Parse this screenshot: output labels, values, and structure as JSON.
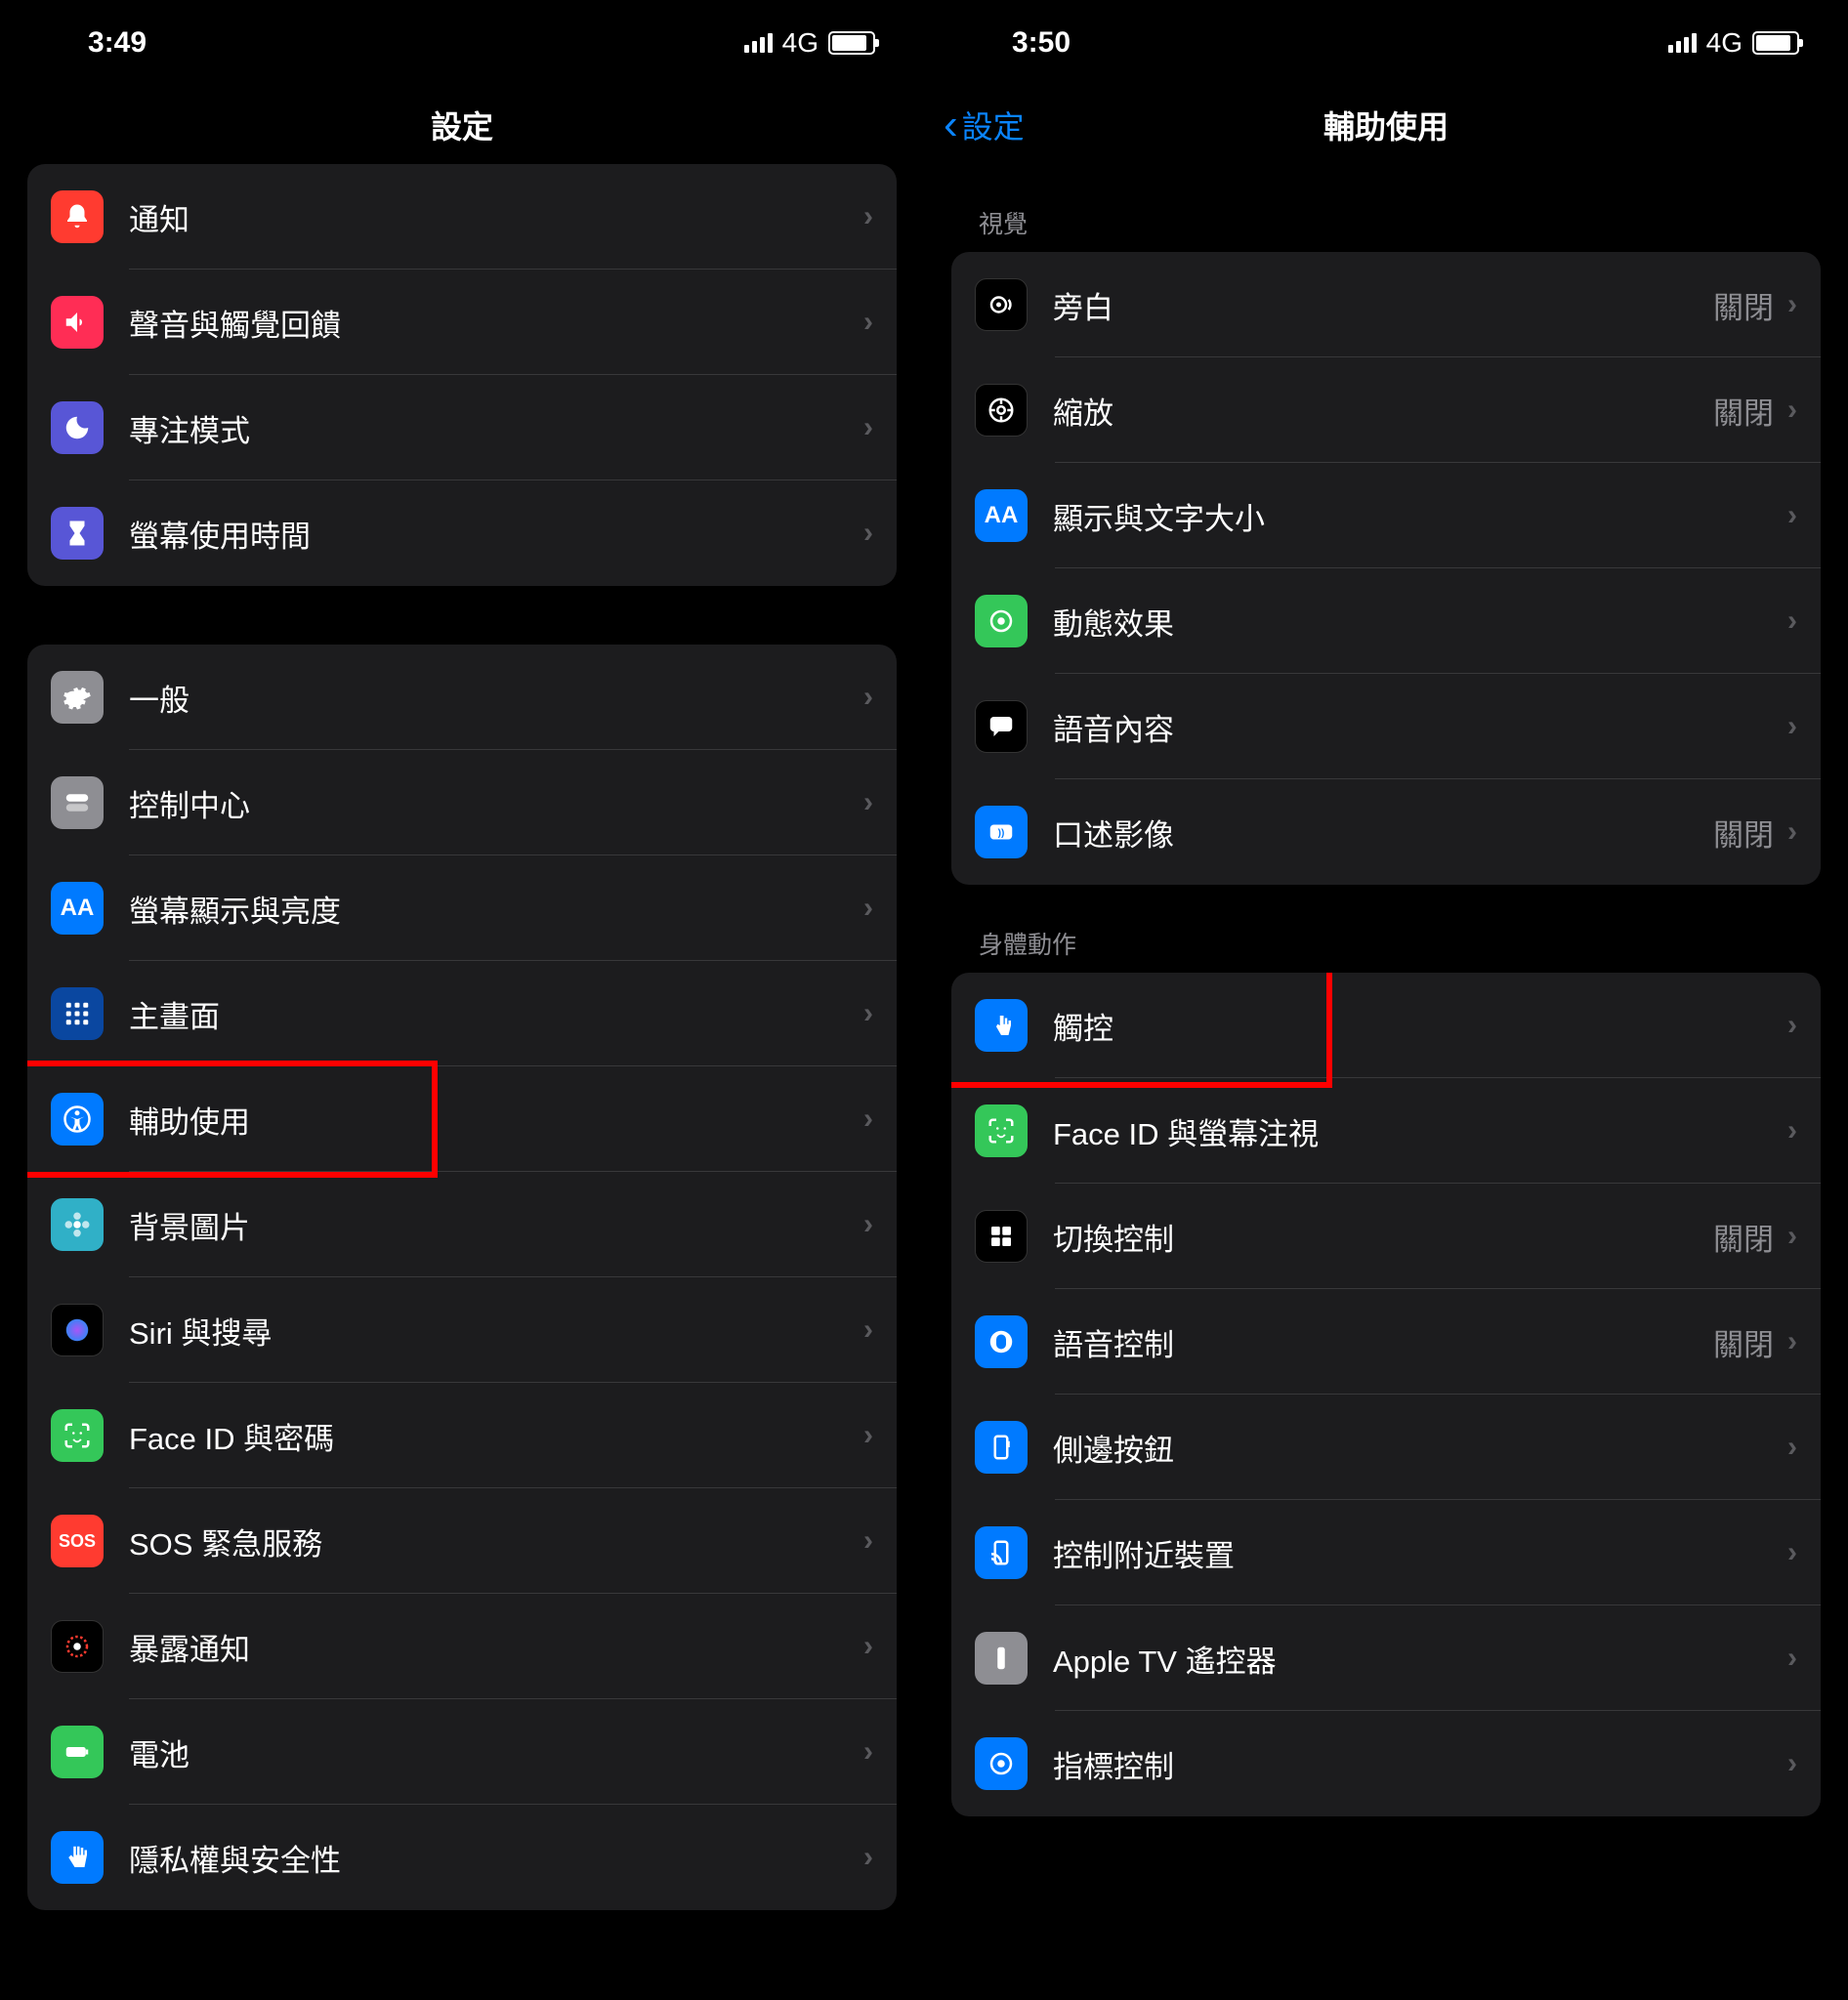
{
  "left": {
    "status": {
      "time": "3:49",
      "network": "4G"
    },
    "title": "設定",
    "groups": [
      {
        "rows": [
          {
            "icon": "bell",
            "bg": "bg-red",
            "label": "通知"
          },
          {
            "icon": "speaker",
            "bg": "bg-pink",
            "label": "聲音與觸覺回饋"
          },
          {
            "icon": "moon",
            "bg": "bg-indigo",
            "label": "專注模式"
          },
          {
            "icon": "hourglass",
            "bg": "bg-indigo",
            "label": "螢幕使用時間"
          }
        ]
      },
      {
        "rows": [
          {
            "icon": "gear",
            "bg": "bg-gray",
            "label": "一般"
          },
          {
            "icon": "toggles",
            "bg": "bg-gray",
            "label": "控制中心"
          },
          {
            "icon": "aa",
            "bg": "bg-blue",
            "label": "螢幕顯示與亮度"
          },
          {
            "icon": "grid",
            "bg": "bg-darkblue",
            "label": "主畫面"
          },
          {
            "icon": "accessibility",
            "bg": "bg-blue",
            "label": "輔助使用",
            "highlight": true
          },
          {
            "icon": "flower",
            "bg": "bg-teal",
            "label": "背景圖片"
          },
          {
            "icon": "siri",
            "bg": "bg-black",
            "label": "Siri 與搜尋"
          },
          {
            "icon": "faceid",
            "bg": "bg-green",
            "label": "Face ID 與密碼"
          },
          {
            "icon": "sos",
            "bg": "bg-red",
            "label": "SOS 緊急服務"
          },
          {
            "icon": "exposure",
            "bg": "bg-black",
            "label": "暴露通知"
          },
          {
            "icon": "battery",
            "bg": "bg-green",
            "label": "電池"
          },
          {
            "icon": "hand",
            "bg": "bg-blue",
            "label": "隱私權與安全性"
          }
        ]
      }
    ]
  },
  "right": {
    "status": {
      "time": "3:50",
      "network": "4G"
    },
    "back": "設定",
    "title": "輔助使用",
    "sections": [
      {
        "header": "視覺",
        "rows": [
          {
            "icon": "voiceover",
            "bg": "bg-black",
            "label": "旁白",
            "value": "關閉"
          },
          {
            "icon": "zoom",
            "bg": "bg-black",
            "label": "縮放",
            "value": "關閉"
          },
          {
            "icon": "aa",
            "bg": "bg-blue",
            "label": "顯示與文字大小"
          },
          {
            "icon": "motion",
            "bg": "bg-green",
            "label": "動態效果"
          },
          {
            "icon": "speech",
            "bg": "bg-black",
            "label": "語音內容"
          },
          {
            "icon": "audio-desc",
            "bg": "bg-blue",
            "label": "口述影像",
            "value": "關閉"
          }
        ]
      },
      {
        "header": "身體動作",
        "rows": [
          {
            "icon": "touch",
            "bg": "bg-blue",
            "label": "觸控",
            "highlight": true
          },
          {
            "icon": "faceid",
            "bg": "bg-green",
            "label": "Face ID 與螢幕注視"
          },
          {
            "icon": "switch",
            "bg": "bg-black",
            "label": "切換控制",
            "value": "關閉"
          },
          {
            "icon": "voice-ctrl",
            "bg": "bg-blue",
            "label": "語音控制",
            "value": "關閉"
          },
          {
            "icon": "side-btn",
            "bg": "bg-blue",
            "label": "側邊按鈕"
          },
          {
            "icon": "nearby",
            "bg": "bg-blue",
            "label": "控制附近裝置"
          },
          {
            "icon": "tv-remote",
            "bg": "bg-gray",
            "label": "Apple TV 遙控器"
          },
          {
            "icon": "pointer",
            "bg": "bg-blue",
            "label": "指標控制"
          }
        ]
      }
    ]
  }
}
